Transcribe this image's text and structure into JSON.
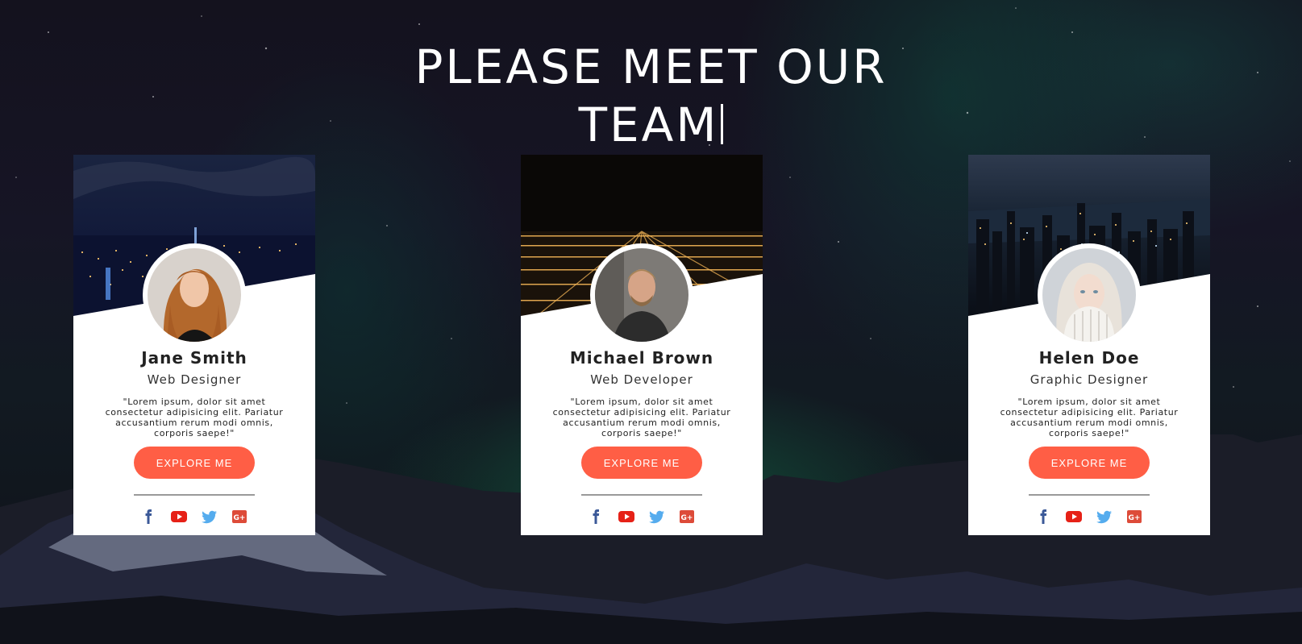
{
  "heading": {
    "line1": "PLEASE MEET OUR",
    "line2": "TEAM"
  },
  "colors": {
    "accent": "#ff5e45",
    "facebook": "#3b5998",
    "youtube": "#e62117",
    "twitter": "#55acee",
    "googleplus": "#dd4b39"
  },
  "team": [
    {
      "name": "Jane Smith",
      "role": "Web Designer",
      "quote": "\"Lorem ipsum, dolor sit amet consectetur adipisicing elit. Pariatur accusantium rerum modi omnis, corporis saepe!\"",
      "button": "EXPLORE ME",
      "socials": [
        "facebook-icon",
        "youtube-icon",
        "twitter-icon",
        "google-plus-icon"
      ]
    },
    {
      "name": "Michael Brown",
      "role": "Web Developer",
      "quote": "\"Lorem ipsum, dolor sit amet consectetur adipisicing elit. Pariatur accusantium rerum modi omnis, corporis saepe!\"",
      "button": "EXPLORE ME",
      "socials": [
        "facebook-icon",
        "youtube-icon",
        "twitter-icon",
        "google-plus-icon"
      ]
    },
    {
      "name": "Helen Doe",
      "role": "Graphic Designer",
      "quote": "\"Lorem ipsum, dolor sit amet consectetur adipisicing elit. Pariatur accusantium rerum modi omnis, corporis saepe!\"",
      "button": "EXPLORE ME",
      "socials": [
        "facebook-icon",
        "youtube-icon",
        "twitter-icon",
        "google-plus-icon"
      ]
    }
  ]
}
